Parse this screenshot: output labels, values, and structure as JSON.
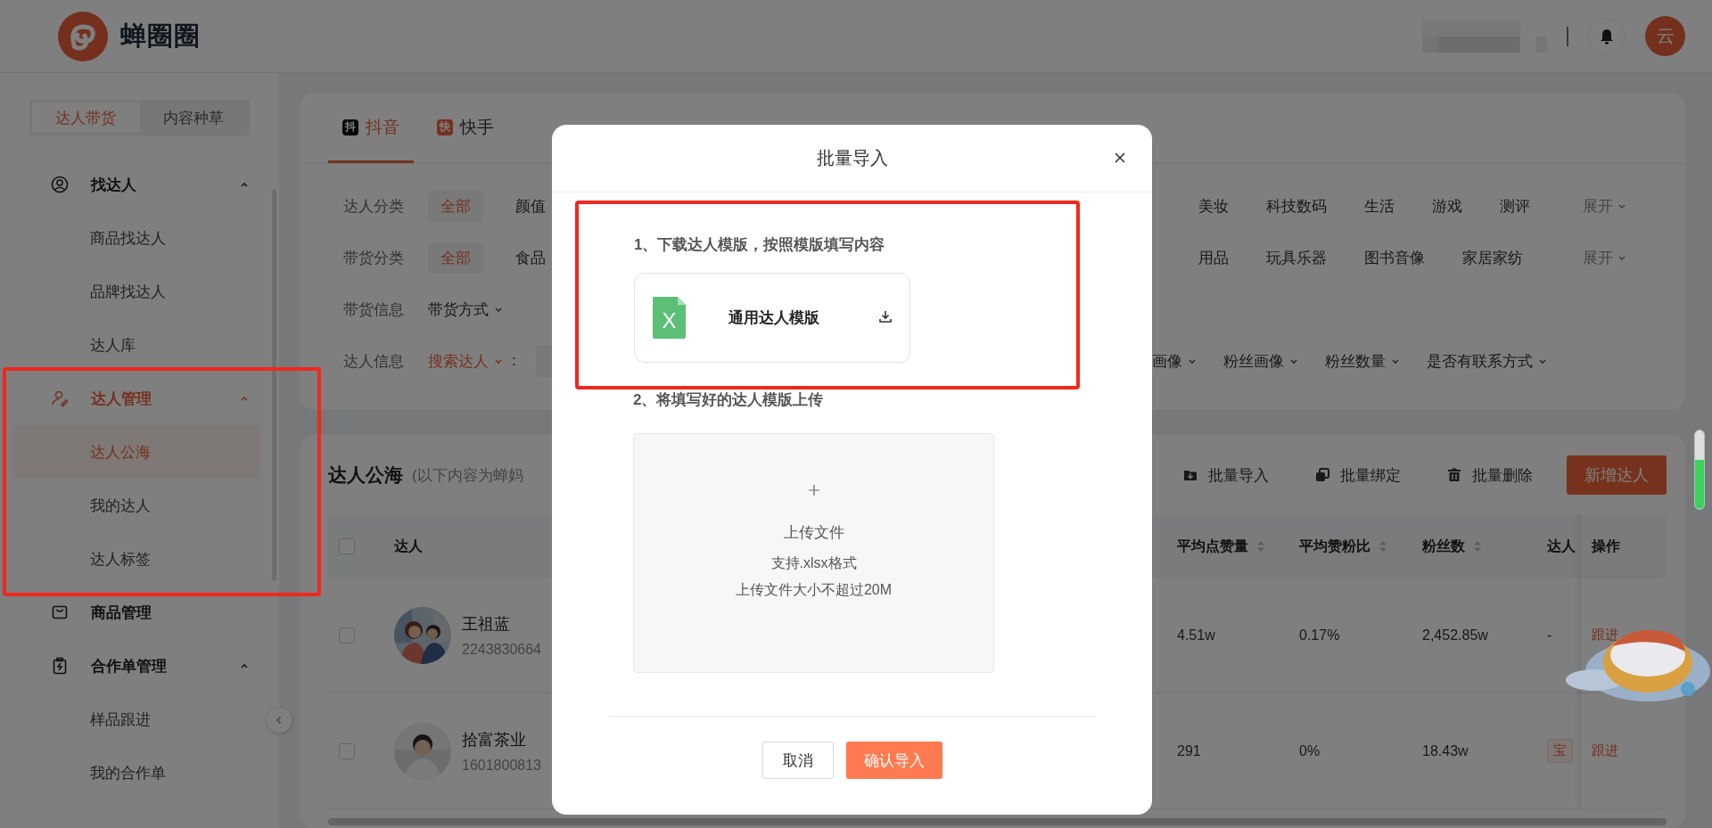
{
  "header": {
    "logo_text": "蝉圈圈",
    "avatar_text": "云"
  },
  "sidebar": {
    "mode_tabs": [
      {
        "label": "达人带货",
        "selected": true
      },
      {
        "label": "内容种草",
        "selected": false
      }
    ],
    "groups": [
      {
        "label": "找达人",
        "expanded": true,
        "active": false,
        "highlighted": false,
        "children": [
          {
            "label": "商品找达人",
            "selected": false
          },
          {
            "label": "品牌找达人",
            "selected": false
          },
          {
            "label": "达人库",
            "selected": false
          }
        ]
      },
      {
        "label": "达人管理",
        "expanded": true,
        "active": true,
        "highlighted": true,
        "children": [
          {
            "label": "达人公海",
            "selected": true
          },
          {
            "label": "我的达人",
            "selected": false
          },
          {
            "label": "达人标签",
            "selected": false
          }
        ]
      },
      {
        "label": "商品管理",
        "active": false,
        "highlighted": false
      },
      {
        "label": "合作单管理",
        "expanded": true,
        "active": false,
        "highlighted": false,
        "children": [
          {
            "label": "样品跟进",
            "selected": false
          },
          {
            "label": "我的合作单",
            "selected": false
          }
        ]
      }
    ]
  },
  "platform_tabs": [
    {
      "label": "抖音",
      "icon_text": "抖",
      "selected": true
    },
    {
      "label": "快手",
      "icon_text": "快",
      "selected": false
    }
  ],
  "filters": [
    {
      "label": "达人分类",
      "kind": "chips",
      "options": [
        {
          "text": "全部",
          "selected": true
        },
        {
          "text": "颜值",
          "selected": false
        }
      ],
      "options_right": [
        {
          "text": "美妆",
          "selected": false
        },
        {
          "text": "科技数码",
          "selected": false
        },
        {
          "text": "生活",
          "selected": false
        },
        {
          "text": "游戏",
          "selected": false
        },
        {
          "text": "测评",
          "selected": false
        }
      ],
      "expand": "展开"
    },
    {
      "label": "带货分类",
      "kind": "chips",
      "options": [
        {
          "text": "全部",
          "selected": true
        },
        {
          "text": "食品",
          "selected": false
        }
      ],
      "options_right": [
        {
          "text": "用品",
          "selected": false
        },
        {
          "text": "玩具乐器",
          "selected": false
        },
        {
          "text": "图书音像",
          "selected": false
        },
        {
          "text": "家居家纺",
          "selected": false
        }
      ],
      "expand": "展开"
    },
    {
      "label": "带货信息",
      "kind": "dropdowns",
      "dropdowns": [
        "带货方式"
      ]
    },
    {
      "label": "达人信息",
      "kind": "search",
      "search_type": "搜索达人",
      "separator": ":",
      "dropdowns_right": [
        "画像",
        "粉丝画像",
        "粉丝数量",
        "是否有联系方式"
      ]
    }
  ],
  "list": {
    "title": "达人公海",
    "subtitle": "(以下内容为蝉妈",
    "actions": [
      "批量导入",
      "批量绑定",
      "批量删除"
    ],
    "primary_action": "新增达人",
    "header_checked": false,
    "columns": [
      {
        "label": "达人",
        "sortable": false
      },
      {
        "label": "平均点赞量",
        "sortable": true
      },
      {
        "label": "平均赞粉比",
        "sortable": true
      },
      {
        "label": "粉丝数",
        "sortable": true
      },
      {
        "label": "达人",
        "sortable": false
      },
      {
        "label": "操作",
        "sortable": false
      }
    ],
    "rows": [
      {
        "checked": false,
        "cells": [
          {
            "kind": "talent",
            "name": "王祖蓝",
            "id": "2243830664"
          },
          {
            "kind": "text",
            "text": "4.51w"
          },
          {
            "kind": "text",
            "text": "0.17%"
          },
          {
            "kind": "text",
            "text": "2,452.85w"
          },
          {
            "kind": "text",
            "text": "-"
          },
          {
            "kind": "link",
            "text": "跟进"
          }
        ]
      },
      {
        "checked": false,
        "cells": [
          {
            "kind": "talent",
            "name": "拾富茶业",
            "id": "1601800813"
          },
          {
            "kind": "text",
            "text": "291"
          },
          {
            "kind": "text",
            "text": "0%"
          },
          {
            "kind": "text",
            "text": "18.43w"
          },
          {
            "kind": "badge",
            "text": "宝"
          },
          {
            "kind": "link",
            "text": "跟进"
          }
        ]
      }
    ]
  },
  "modal": {
    "title": "批量导入",
    "step1": {
      "text": "1、下载达人模版，按照模版填写内容",
      "highlighted": true
    },
    "template": {
      "name": "通用达人模版",
      "icon_text": "X"
    },
    "step2": "2、将填写好的达人模版上传",
    "upload": {
      "title": "上传文件",
      "lines": [
        "支持.xlsx格式",
        "上传文件大小不超过20M"
      ]
    },
    "cancel": "取消",
    "confirm": "确认导入"
  }
}
